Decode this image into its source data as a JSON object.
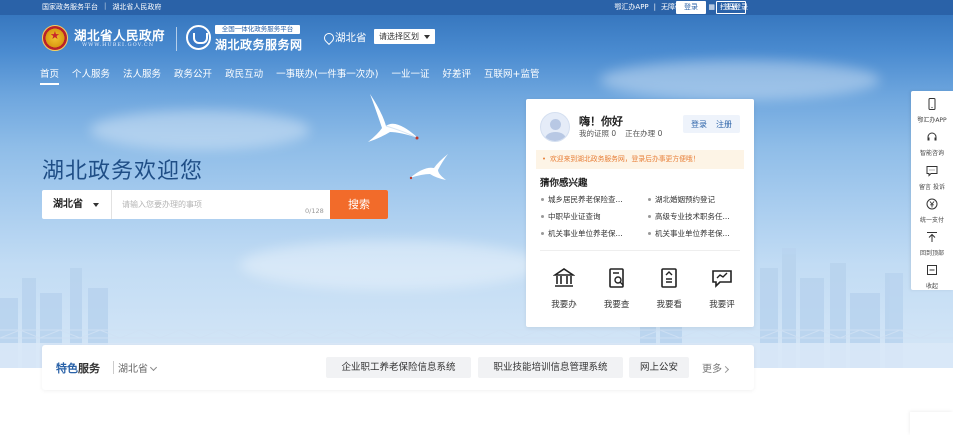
{
  "topbar": {
    "link_platform": "国家政务服务平台",
    "link_gov": "湖北省人民政府",
    "app": "鄂汇办APP",
    "accessible": "无障碍阅读",
    "scan_login": "扫码登录",
    "login": "登录",
    "register": "注册"
  },
  "header": {
    "gov_title": "湖北省人民政府",
    "gov_url": "WWW.HUBEI.GOV.CN",
    "svc_tag": "全国一体化政务服务平台",
    "svc_name": "湖北政务服务网",
    "location": "湖北省",
    "region_select": "请选择区划"
  },
  "nav": {
    "items": [
      "首页",
      "个人服务",
      "法人服务",
      "政务公开",
      "政民互动",
      "一事联办(一件事一次办)",
      "一业一证",
      "好差评",
      "互联网+监管"
    ],
    "active": "首页"
  },
  "hero": {
    "welcome": "湖北政务欢迎您",
    "search_province": "湖北省",
    "search_placeholder": "请输入您要办理的事项",
    "search_count": "0/128",
    "search_button": "搜索"
  },
  "card": {
    "greeting": "嗨！你好",
    "licenses_label": "我的证照",
    "licenses_count": "0",
    "processing_label": "正在办理",
    "processing_count": "0",
    "login": "登录",
    "register": "注册",
    "notice": "欢迎来到湖北政务服务网，登录后办事更方便哦！",
    "interest_title": "猜你感兴趣",
    "interests": [
      "城乡居民养老保险查...",
      "湖北婚姻预约登记",
      "中职毕业证查询",
      "高级专业技术职务任...",
      "机关事业单位养老保...",
      "机关事业单位养老保..."
    ],
    "quick": [
      "我要办",
      "我要查",
      "我要看",
      "我要评"
    ]
  },
  "float": {
    "items": [
      "鄂汇办APP",
      "智能咨询",
      "留言 投诉",
      "统一支付",
      "回到顶部",
      "收起"
    ]
  },
  "strip": {
    "brand_a": "特色",
    "brand_b": "服务",
    "province": "湖北省",
    "tags": [
      "企业职工养老保险信息系统",
      "职业技能培训信息管理系统",
      "网上公安"
    ],
    "more": "更多"
  },
  "colors": {
    "primary": "#2a62a8",
    "accent": "#f26b2a",
    "notice_text": "#e8803a"
  }
}
